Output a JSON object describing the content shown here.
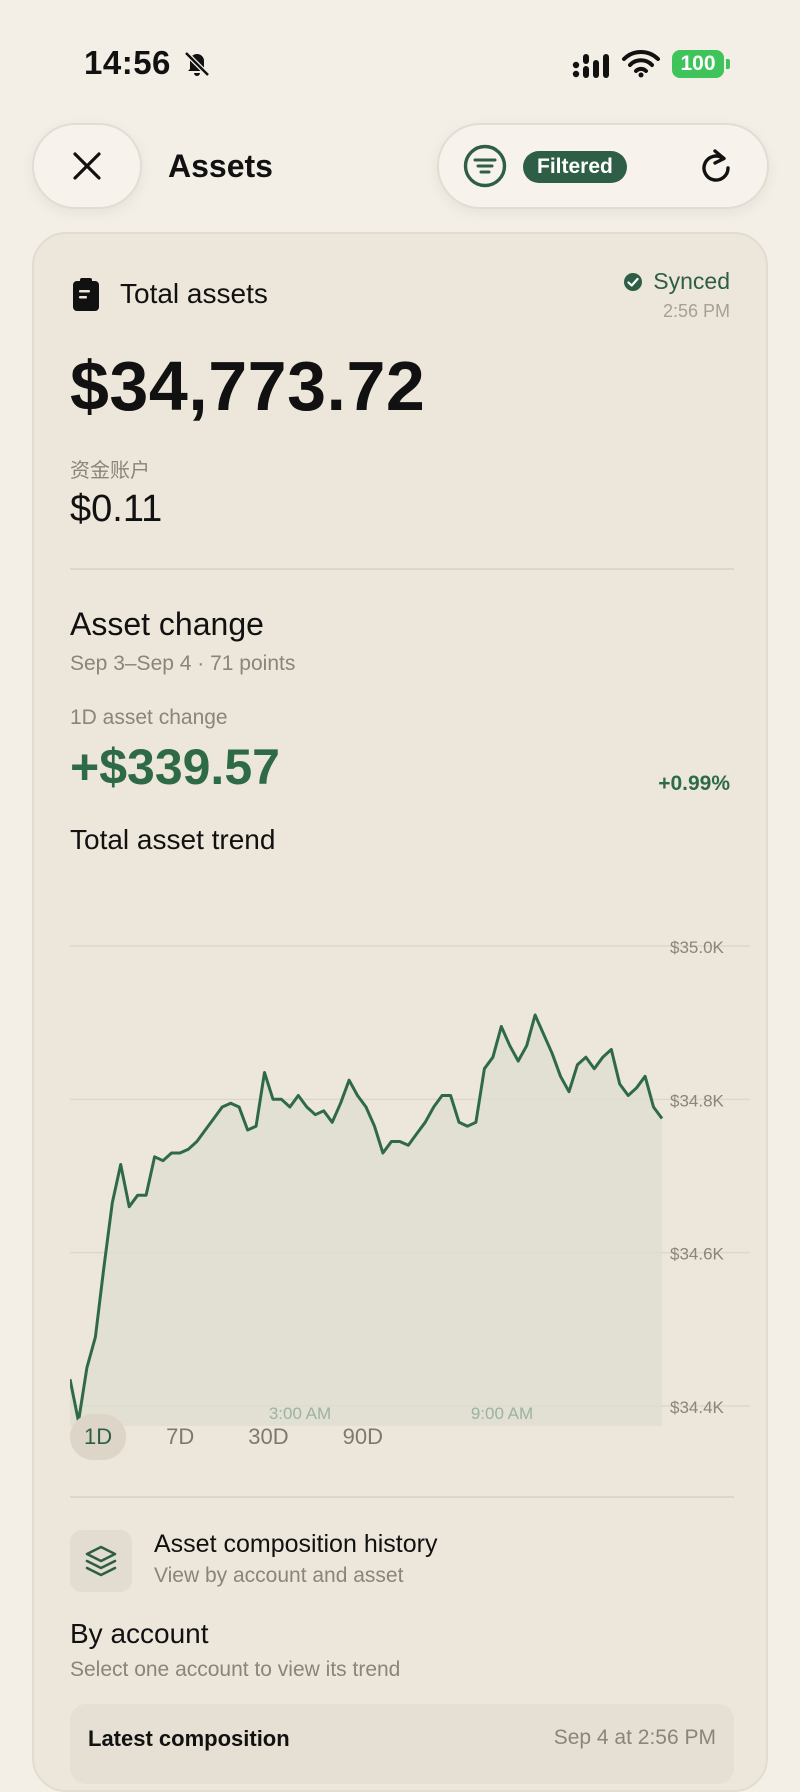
{
  "status_bar": {
    "time": "14:56",
    "battery": "100"
  },
  "header": {
    "title": "Assets",
    "filter_chip": "Filtered"
  },
  "summary": {
    "total_label": "Total assets",
    "synced_label": "Synced",
    "synced_time": "2:56 PM",
    "total_value": "$34,773.72",
    "fund_label": "资金账户",
    "fund_value": "$0.11"
  },
  "asset_change": {
    "title": "Asset change",
    "range": "Sep 3–Sep 4 · 71 points",
    "label": "1D asset change",
    "value": "+$339.57",
    "percent": "+0.99%"
  },
  "trend": {
    "title": "Total asset trend"
  },
  "range_tabs": [
    {
      "label": "1D",
      "active": true
    },
    {
      "label": "7D",
      "active": false
    },
    {
      "label": "30D",
      "active": false
    },
    {
      "label": "90D",
      "active": false
    }
  ],
  "composition": {
    "title": "Asset composition history",
    "subtitle": "View by account and asset"
  },
  "by_account": {
    "title": "By account",
    "subtitle": "Select one account to view its trend"
  },
  "latest": {
    "label": "Latest composition",
    "date": "Sep 4 at 2:56 PM"
  },
  "colors": {
    "accent": "#2f5e46",
    "positive": "#2f6a47",
    "background": "#f4efe6",
    "card": "#ede6da"
  },
  "chart_data": {
    "type": "area",
    "title": "Total asset trend",
    "y_tick_labels": [
      "$35.0K",
      "$34.8K",
      "$34.6K",
      "$34.4K"
    ],
    "y_ticks": [
      35000,
      34800,
      34600,
      34400
    ],
    "x_tick_labels": [
      "3:00 AM",
      "9:00 AM"
    ],
    "ylim": [
      34400,
      35000
    ],
    "grid": true,
    "y_axis_position": "right",
    "series": [
      {
        "values": [
          34435,
          34380,
          34450,
          34490,
          34580,
          34665,
          34715,
          34660,
          34675,
          34675,
          34725,
          34720,
          34730,
          34730,
          34735,
          34745,
          34760,
          34775,
          34790,
          34795,
          34790,
          34760,
          34765,
          34835,
          34800,
          34800,
          34790,
          34805,
          34790,
          34780,
          34785,
          34770,
          34795,
          34825,
          34805,
          34790,
          34765,
          34730,
          34745,
          34745,
          34740,
          34755,
          34770,
          34790,
          34805,
          34805,
          34770,
          34765,
          34770,
          34840,
          34855,
          34895,
          34870,
          34850,
          34870,
          34910,
          34885,
          34860,
          34830,
          34810,
          34845,
          34855,
          34840,
          34855,
          34865,
          34820,
          34805,
          34815,
          34830,
          34790,
          34775
        ]
      }
    ]
  }
}
